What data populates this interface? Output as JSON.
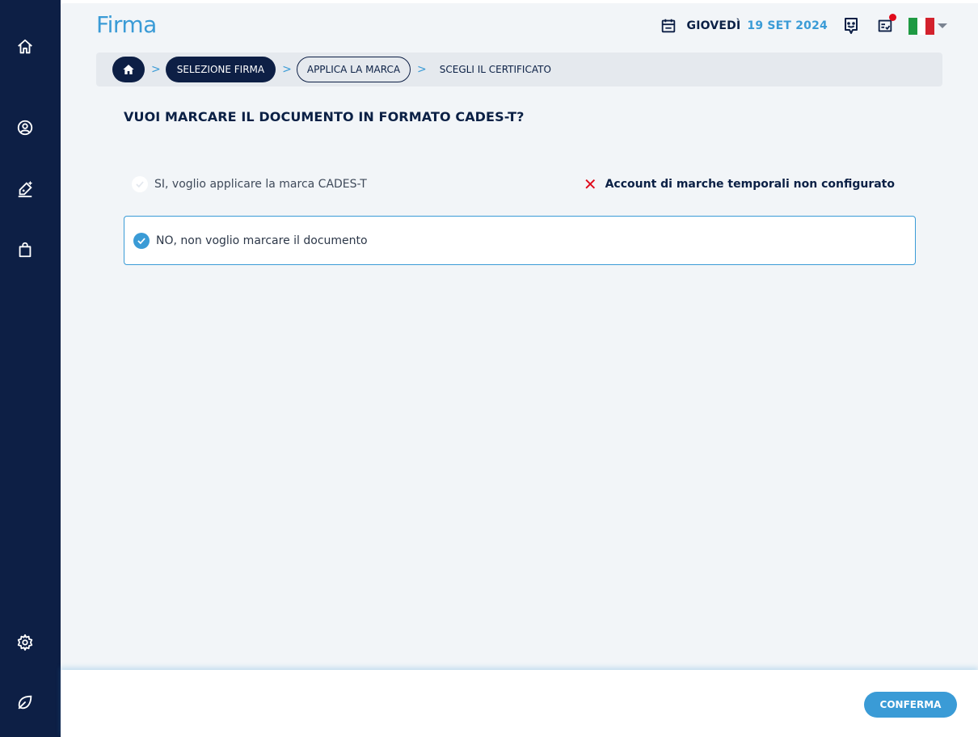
{
  "header": {
    "title": "Firma",
    "date_day": "GIOVEDÌ",
    "date_rest": "19 SET 2024",
    "language_flag": "italy-flag"
  },
  "breadcrumb": {
    "step1": "SELEZIONE FIRMA",
    "step2": "APPLICA LA MARCA",
    "step3": "SCEGLI IL CERTIFICATO"
  },
  "question": "VUOI MARCARE IL DOCUMENTO IN FORMATO CADES-T?",
  "options": {
    "yes_label": "SI, voglio applicare la marca CADES-T",
    "yes_error": "Account di marche temporali non configurato",
    "no_label": "NO, non voglio marcare il documento"
  },
  "footer": {
    "confirm_label": "CONFERMA"
  },
  "colors": {
    "sidebar": "#0d1f45",
    "accent": "#3a9bd6",
    "error": "#e00b1c"
  }
}
